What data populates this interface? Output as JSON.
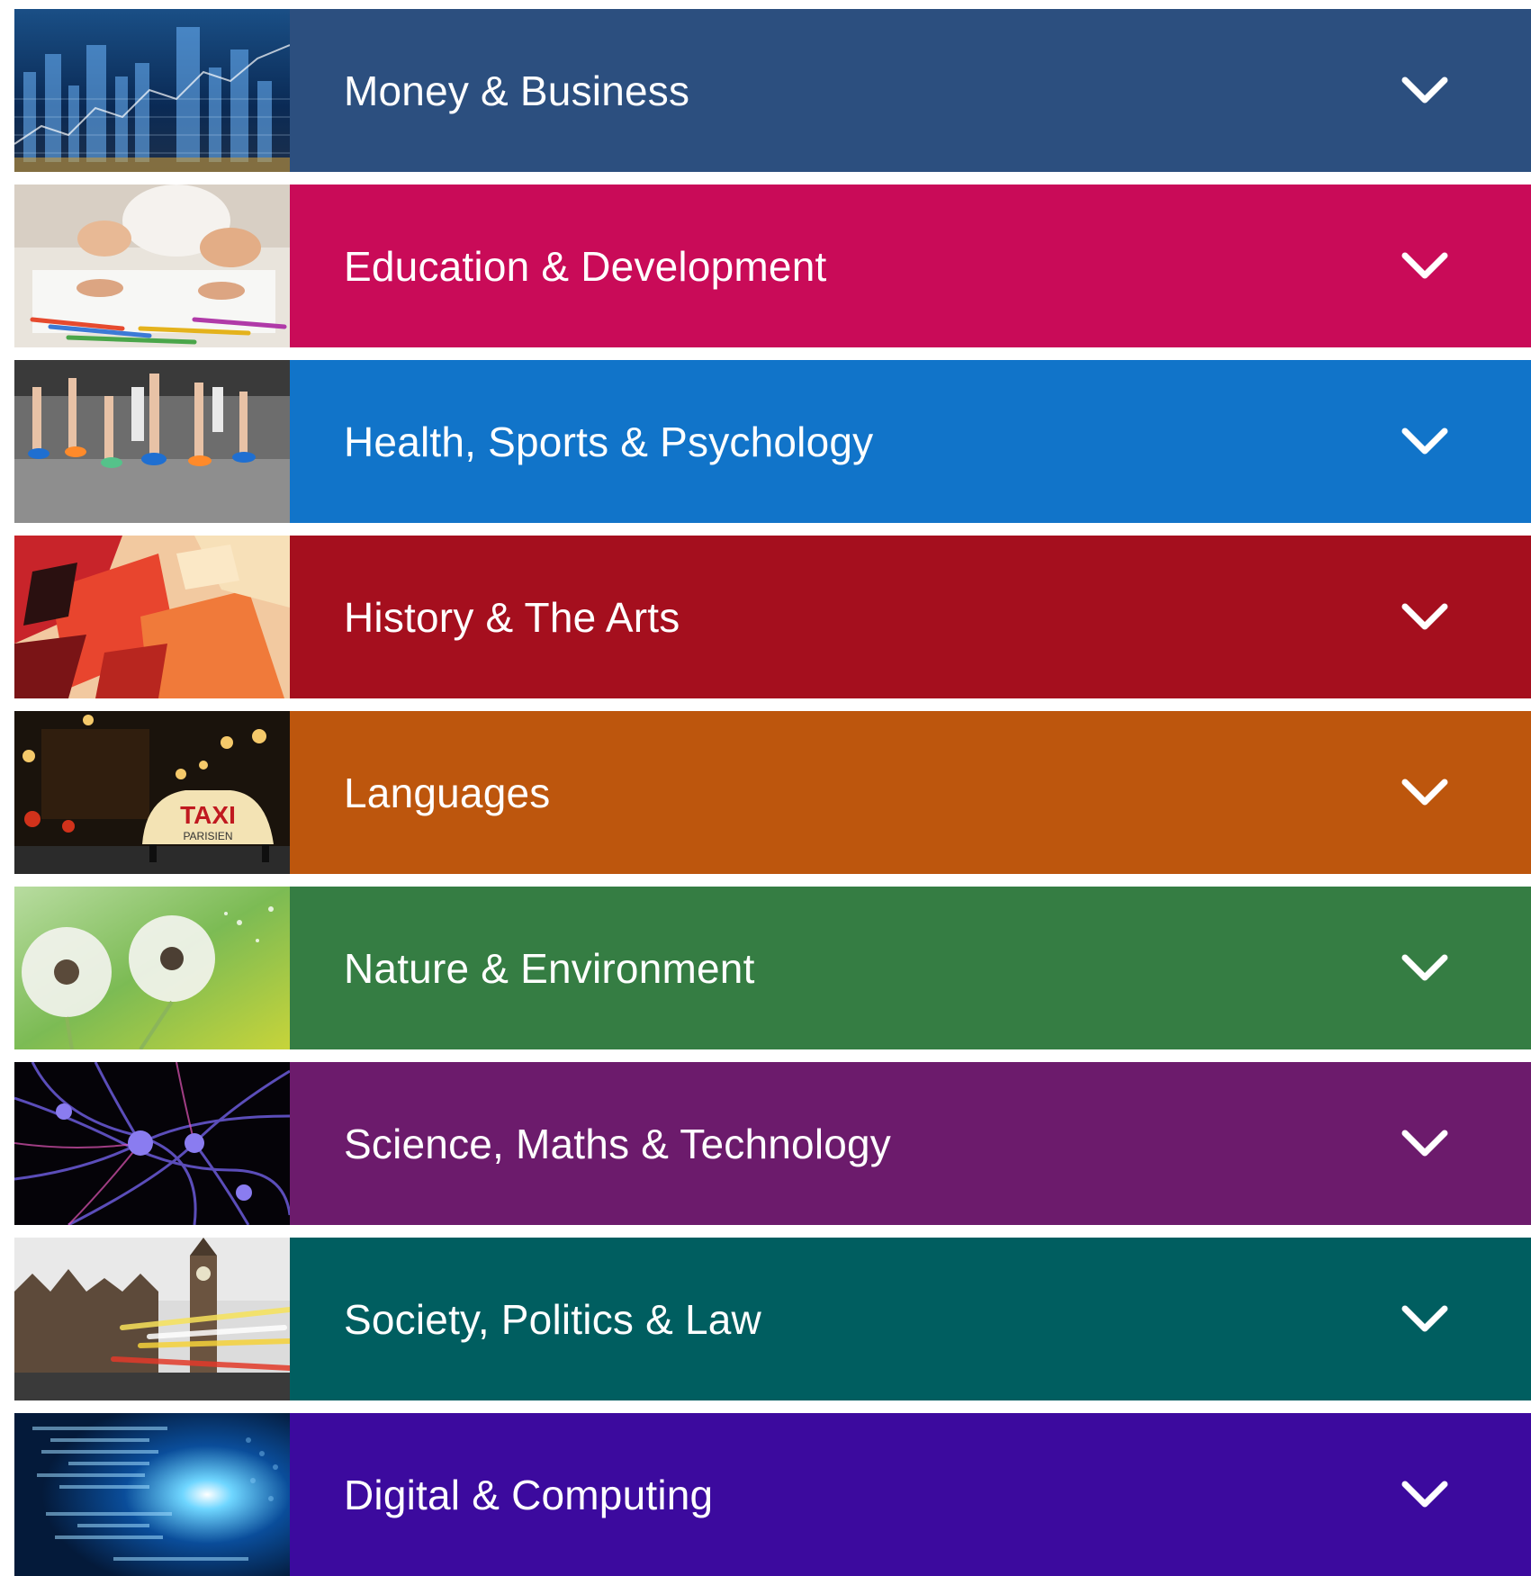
{
  "categories": [
    {
      "label": "Money & Business",
      "color": "#2c4f7f",
      "icon": "chevron-down-icon",
      "image": "city-finance-image"
    },
    {
      "label": "Education & Development",
      "color": "#c90b58",
      "icon": "chevron-down-icon",
      "image": "children-drawing-image"
    },
    {
      "label": "Health, Sports & Psychology",
      "color": "#1174c9",
      "icon": "chevron-down-icon",
      "image": "runners-image"
    },
    {
      "label": "History & The Arts",
      "color": "#a50f1e",
      "icon": "chevron-down-icon",
      "image": "paint-abstract-image"
    },
    {
      "label": "Languages",
      "color": "#bd560d",
      "icon": "chevron-down-icon",
      "image": "paris-taxi-image"
    },
    {
      "label": "Nature & Environment",
      "color": "#357d43",
      "icon": "chevron-down-icon",
      "image": "dandelion-image"
    },
    {
      "label": "Science, Maths & Technology",
      "color": "#6c1b6c",
      "icon": "chevron-down-icon",
      "image": "neurons-image"
    },
    {
      "label": "Society, Politics & Law",
      "color": "#005e60",
      "icon": "chevron-down-icon",
      "image": "westminster-image"
    },
    {
      "label": "Digital & Computing",
      "color": "#3c0a9e",
      "icon": "chevron-down-icon",
      "image": "digital-code-image"
    }
  ]
}
